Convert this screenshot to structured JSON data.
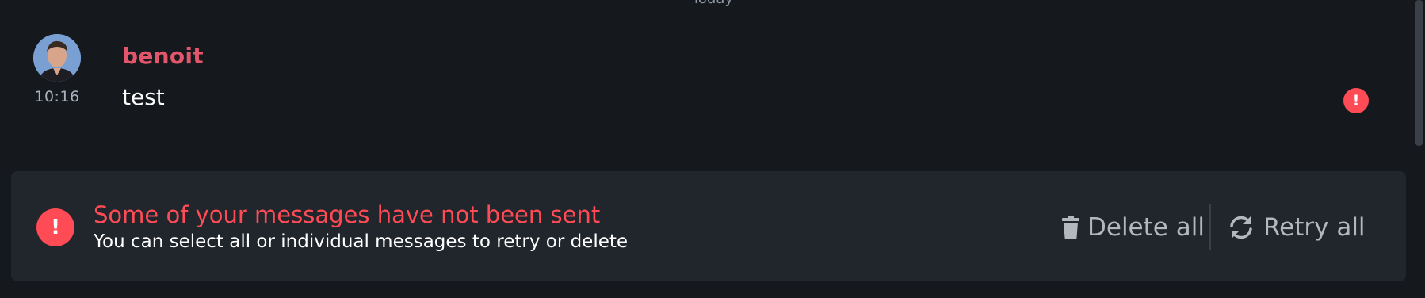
{
  "date_separator": "Today",
  "message": {
    "sender": "benoit",
    "time": "10:16",
    "body": "test",
    "error_glyph": "!"
  },
  "banner": {
    "icon_glyph": "!",
    "title": "Some of your messages have not been sent",
    "subtitle": "You can select all or individual messages to retry or delete",
    "delete_label": "Delete all",
    "retry_label": "Retry all"
  },
  "colors": {
    "background": "#15191e",
    "banner_background": "#21262c",
    "sender": "#e2556a",
    "error": "#ff4b55",
    "action_text": "#b1b8c0"
  },
  "icons": {
    "delete": "trash-icon",
    "retry": "refresh-icon",
    "error": "exclamation-icon"
  }
}
